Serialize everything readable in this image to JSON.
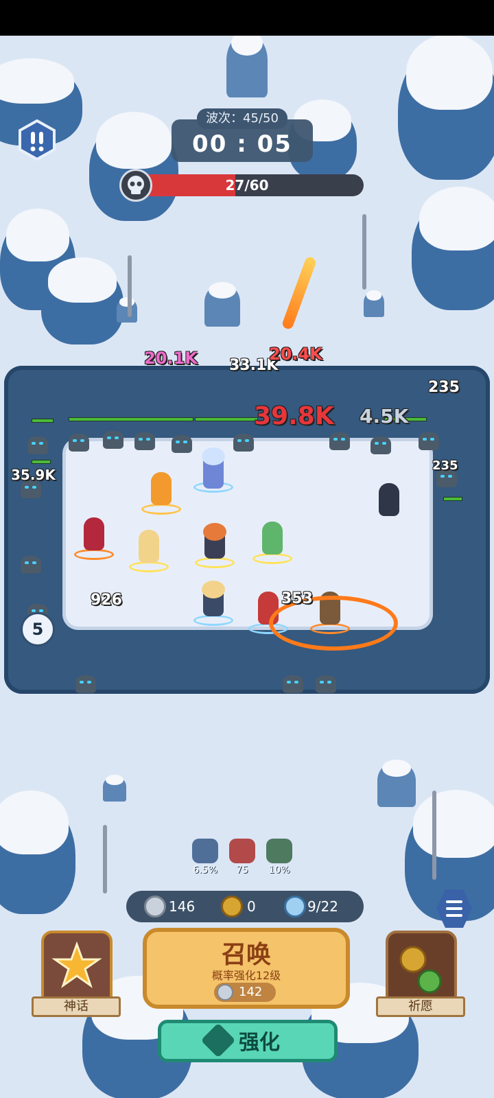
{
  "hud": {
    "wave_label": "波次：45/50",
    "timer": "00 : 05",
    "boss_progress": "27/60",
    "boss_fill_fraction": 0.45,
    "menu_icon": "exclamation-hex-icon"
  },
  "damage_numbers": [
    {
      "text": "20.1K",
      "color": "#f06acb"
    },
    {
      "text": "33.1K",
      "color": "#ffffff"
    },
    {
      "text": "20.4K",
      "color": "#ff4d4d"
    },
    {
      "text": "235",
      "color": "#ffffff"
    },
    {
      "text": "39.8K",
      "color": "#e8363b"
    },
    {
      "text": "4.5K",
      "color": "#c8d3df"
    },
    {
      "text": "35.9K",
      "color": "#ffffff"
    },
    {
      "text": "235",
      "color": "#ffffff"
    },
    {
      "text": "926",
      "color": "#ffffff"
    },
    {
      "text": "353",
      "color": "#ffffff"
    }
  ],
  "enemy_counter": "5",
  "buffs": [
    {
      "icon": "crit-shield-icon",
      "value": "6.5%"
    },
    {
      "icon": "attack-sword-icon",
      "value": "75"
    },
    {
      "icon": "speed-arrow-icon",
      "value": "10%"
    }
  ],
  "resources": {
    "silver": {
      "icon": "silver-coin-icon",
      "value": "146"
    },
    "clover": {
      "icon": "clover-coin-icon",
      "value": "0"
    },
    "units": {
      "icon": "unit-head-icon",
      "value": "9/22"
    }
  },
  "summon": {
    "title": "召唤",
    "subtitle": "概率强化12级",
    "cost": "142"
  },
  "upgrade": {
    "label": "强化"
  },
  "mythic": {
    "label": "神话"
  },
  "wish": {
    "label": "祈愿"
  },
  "colors": {
    "accent_gold": "#f4c36a",
    "accent_teal": "#58d6b5",
    "boss_red": "#d9383b"
  }
}
